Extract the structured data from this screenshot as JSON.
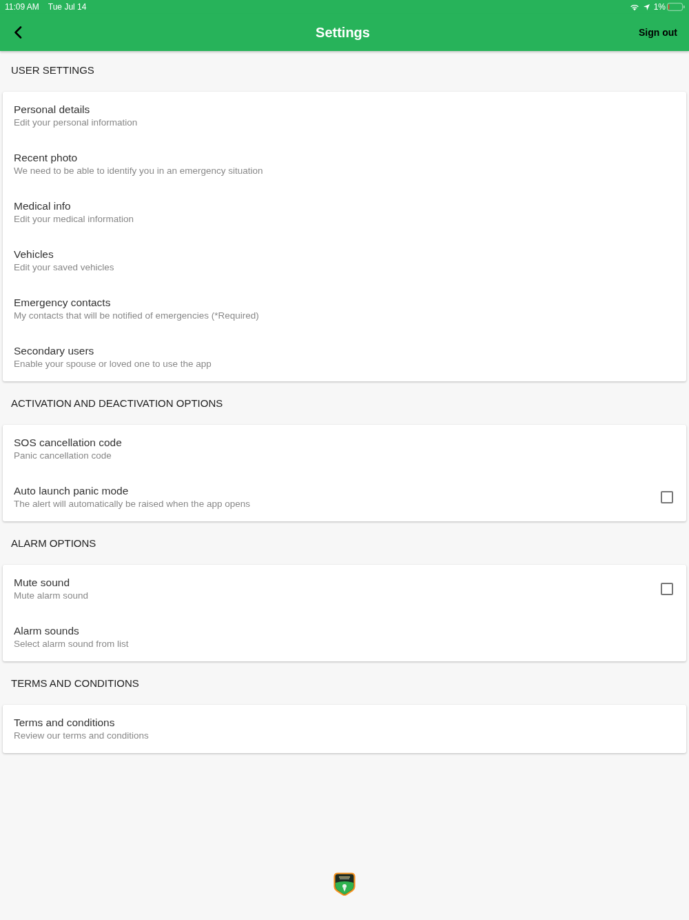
{
  "status_bar": {
    "time": "11:09 AM",
    "date": "Tue Jul 14",
    "battery_text": "1%"
  },
  "header": {
    "title": "Settings",
    "action": "Sign out"
  },
  "sections": [
    {
      "heading": "USER SETTINGS",
      "items": [
        {
          "kind": "link",
          "title": "Personal details",
          "subtitle": "Edit your personal information"
        },
        {
          "kind": "link",
          "title": "Recent photo",
          "subtitle": "We need to be able to identify you in an emergency situation"
        },
        {
          "kind": "link",
          "title": "Medical info",
          "subtitle": "Edit your medical information"
        },
        {
          "kind": "link",
          "title": "Vehicles",
          "subtitle": "Edit your saved vehicles"
        },
        {
          "kind": "link",
          "title": "Emergency contacts",
          "subtitle": "My contacts that will be notified of emergencies (*Required)"
        },
        {
          "kind": "link",
          "title": "Secondary users",
          "subtitle": "Enable your spouse or loved one to use the app"
        }
      ]
    },
    {
      "heading": "ACTIVATION AND DEACTIVATION OPTIONS",
      "items": [
        {
          "kind": "link",
          "title": "SOS cancellation code",
          "subtitle": "Panic cancellation code"
        },
        {
          "kind": "checkbox",
          "title": "Auto launch panic mode",
          "subtitle": "The alert will automatically be raised when the app opens",
          "checked": false
        }
      ]
    },
    {
      "heading": "ALARM OPTIONS",
      "items": [
        {
          "kind": "checkbox",
          "title": "Mute sound",
          "subtitle": "Mute alarm sound",
          "checked": false
        },
        {
          "kind": "link",
          "title": "Alarm sounds",
          "subtitle": "Select alarm sound from list"
        }
      ]
    },
    {
      "heading": "TERMS AND CONDITIONS",
      "items": [
        {
          "kind": "link",
          "title": "Terms and conditions",
          "subtitle": "Review our terms and conditions"
        }
      ]
    }
  ]
}
